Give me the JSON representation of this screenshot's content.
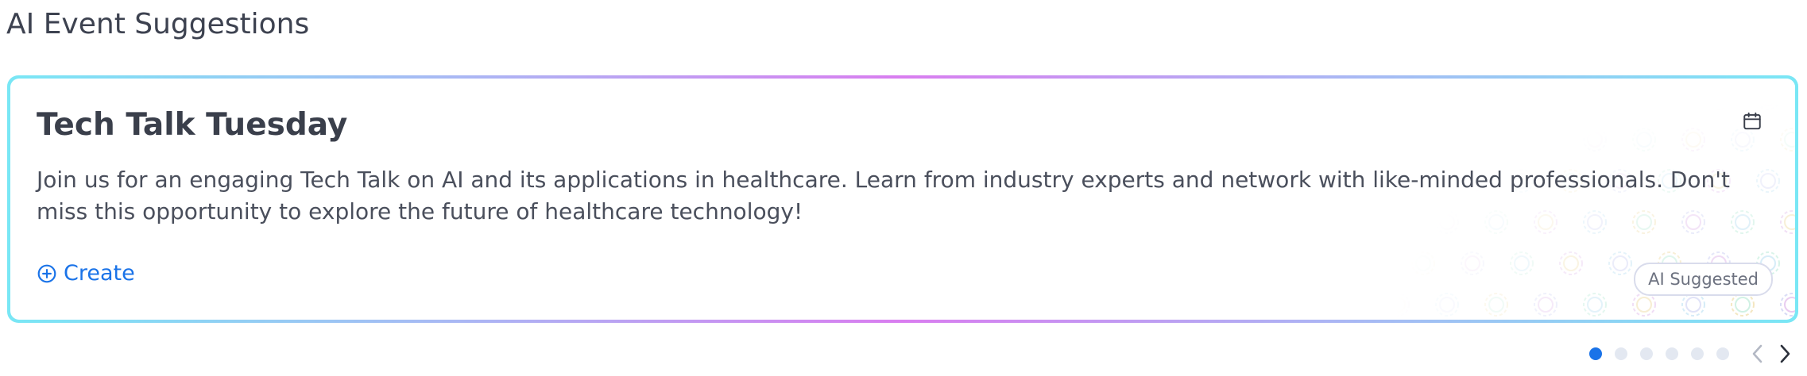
{
  "section": {
    "title": "AI Event Suggestions"
  },
  "card": {
    "title": "Tech Talk Tuesday",
    "description": "Join us for an engaging Tech Talk on AI and its applications in healthcare. Learn from industry experts and network with like-minded professionals. Don't miss this opportunity to explore the future of healthcare technology!",
    "create_label": "Create",
    "badge_label": "AI Suggested",
    "icons": {
      "calendar": "calendar-icon",
      "create": "plus-circle-icon"
    },
    "colors": {
      "border_gradient": [
        "#79e7f5",
        "#a9b8f4",
        "#d97df0"
      ],
      "accent": "#1a73e8"
    }
  },
  "pagination": {
    "total_pages": 6,
    "current_page": 1,
    "prev_icon": "chevron-left-icon",
    "next_icon": "chevron-right-icon",
    "active_color": "#1a73e8",
    "inactive_color": "#e3e8f1"
  }
}
